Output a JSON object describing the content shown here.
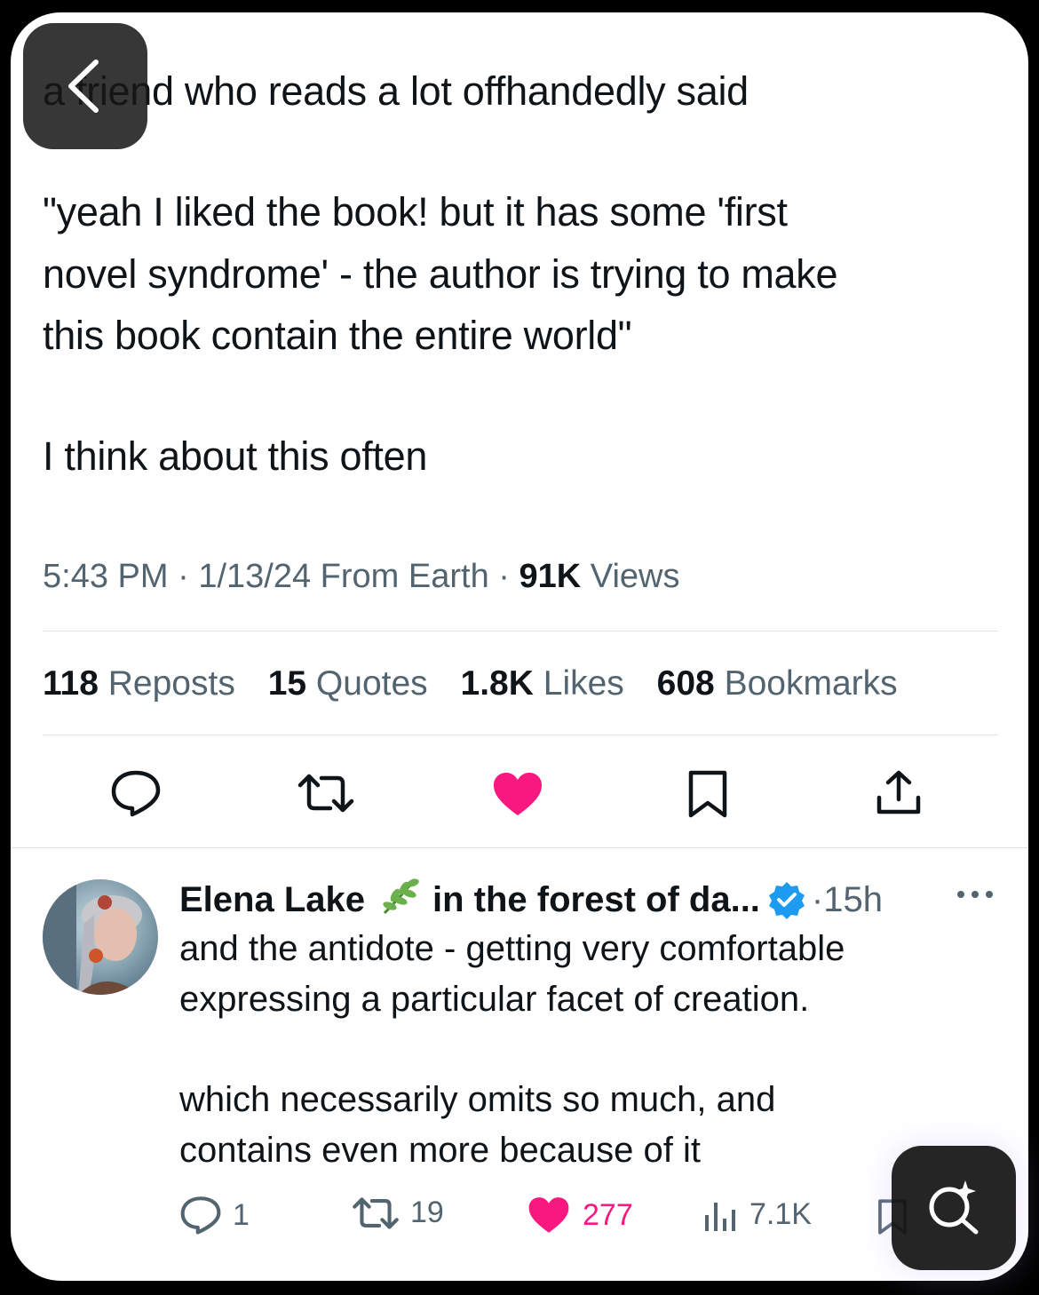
{
  "tweet": {
    "lines": [
      "a friend who reads a lot offhandedly said",
      "\"yeah I liked the book! but it has some 'first",
      "novel syndrome' - the author is trying to make",
      "this book contain the entire world\"",
      "I think about this often"
    ],
    "time": "5:43 PM",
    "date": "1/13/24",
    "location": "From Earth",
    "views_count": "91K",
    "views_label": "Views"
  },
  "stats": [
    {
      "count": "118",
      "label": "Reposts"
    },
    {
      "count": "15",
      "label": "Quotes"
    },
    {
      "count": "1.8K",
      "label": "Likes"
    },
    {
      "count": "608",
      "label": "Bookmarks"
    }
  ],
  "colors": {
    "like": "#f91880",
    "verified": "#1d9bf0",
    "secondary_text": "#536471"
  },
  "actions": [
    "reply-icon",
    "repost-icon",
    "like-icon",
    "bookmark-icon",
    "share-icon"
  ],
  "reply": {
    "author": "Elena Lake",
    "emoji": "🌿",
    "display_suffix": "in the forest of da...",
    "separator": "·",
    "time": "15h",
    "lines": [
      "and the antidote - getting very comfortable",
      "expressing a particular facet of creation.",
      "which necessarily omits so much, and",
      "contains even more because of it"
    ],
    "replies": "1",
    "reposts": "19",
    "likes": "277",
    "views": "7.1K"
  }
}
